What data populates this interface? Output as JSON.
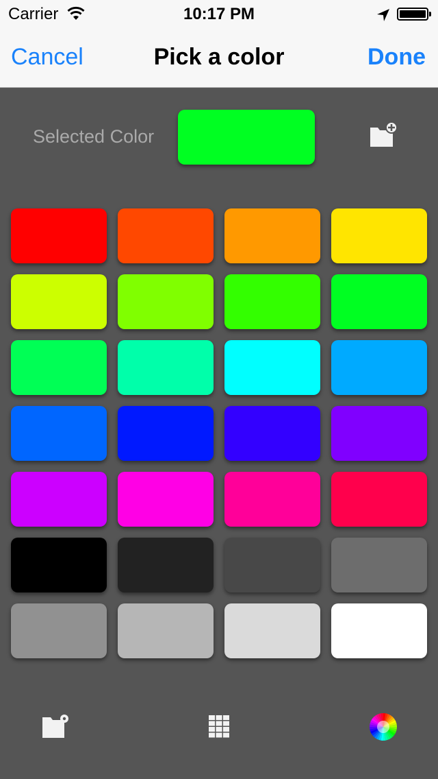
{
  "status_bar": {
    "carrier": "Carrier",
    "time": "10:17 PM",
    "icons": [
      "wifi-icon",
      "location-arrow-icon",
      "battery-icon"
    ]
  },
  "nav": {
    "cancel_label": "Cancel",
    "title": "Pick a color",
    "done_label": "Done"
  },
  "selected": {
    "label": "Selected Color",
    "color": "#00ff22",
    "action_icon": "add-folder-icon"
  },
  "palette": [
    [
      "#ff0000",
      "#ff4800",
      "#ff9900",
      "#ffe500"
    ],
    [
      "#ccff00",
      "#80ff00",
      "#33ff00",
      "#00ff22"
    ],
    [
      "#00ff55",
      "#00ffaa",
      "#00ffff",
      "#00aaff"
    ],
    [
      "#0066ff",
      "#0019ff",
      "#3300ff",
      "#8000ff"
    ],
    [
      "#cc00ff",
      "#ff00e5",
      "#ff0099",
      "#ff004c"
    ],
    [
      "#000000",
      "#222222",
      "#484848",
      "#6d6d6d"
    ],
    [
      "#919191",
      "#b6b6b6",
      "#dadada",
      "#ffffff"
    ]
  ],
  "tab_bar": {
    "items": [
      "folder-settings-icon",
      "grid-icon",
      "color-wheel-icon"
    ]
  }
}
